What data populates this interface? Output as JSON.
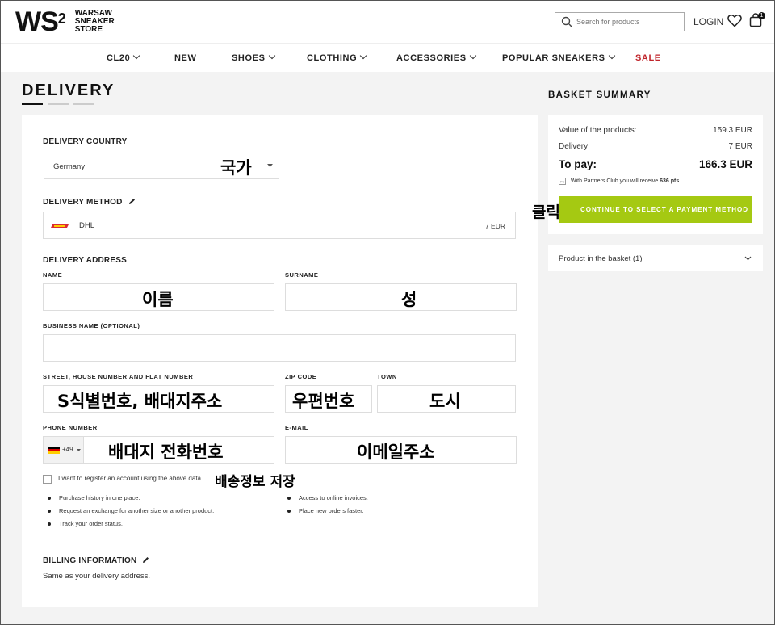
{
  "brand": {
    "mark": "WS",
    "sup": "2",
    "line1": "WARSAW",
    "line2": "SNEAKER",
    "line3": "STORE"
  },
  "header": {
    "search_placeholder": "Search for products",
    "login": "LOGIN",
    "bag_count": "1"
  },
  "nav": [
    {
      "label": "CL20",
      "dropdown": true
    },
    {
      "label": "NEW",
      "dropdown": false
    },
    {
      "label": "SHOES",
      "dropdown": true
    },
    {
      "label": "CLOTHING",
      "dropdown": true
    },
    {
      "label": "ACCESSORIES",
      "dropdown": true
    },
    {
      "label": "POPULAR SNEAKERS",
      "dropdown": true
    },
    {
      "label": "SALE",
      "dropdown": false
    }
  ],
  "page": {
    "title": "DELIVERY"
  },
  "form": {
    "country_label": "DELIVERY COUNTRY",
    "country_value": "Germany",
    "country_note": "국가",
    "method_label": "DELIVERY METHOD",
    "method_name": "DHL",
    "method_price": "7 EUR",
    "address_label": "DELIVERY ADDRESS",
    "name_label": "NAME",
    "name_note": "이름",
    "surname_label": "SURNAME",
    "surname_note": "성",
    "business_label": "BUSINESS NAME (OPTIONAL)",
    "street_label": "STREET, HOUSE NUMBER AND FLAT NUMBER",
    "street_note": "S식별번호, 배대지주소",
    "zip_label": "ZIP CODE",
    "zip_note": "우편번호",
    "town_label": "TOWN",
    "town_note": "도시",
    "phone_label": "PHONE NUMBER",
    "phone_prefix": "+49",
    "phone_note": "배대지 전화번호",
    "email_label": "E-MAIL",
    "email_note": "이메일주소",
    "register_text": "I want to register an account using the above data.",
    "register_note": "배송정보 저장",
    "benefits_left": [
      "Purchase history in one place.",
      "Request an exchange for another size or another product.",
      "Track your order status."
    ],
    "benefits_right": [
      "Access to online invoices.",
      "Place new orders faster."
    ],
    "billing_label": "BILLING INFORMATION",
    "billing_value": "Same as your delivery address."
  },
  "summary": {
    "title": "BASKET SUMMARY",
    "products_label": "Value of the products:",
    "products_value": "159.3 EUR",
    "delivery_label": "Delivery:",
    "delivery_value": "7 EUR",
    "pay_label": "To pay:",
    "pay_value": "166.3 EUR",
    "club_text": "With Partners Club you will receive",
    "club_points": "636 pts",
    "button_label": "CONTINUE TO SELECT A PAYMENT METHOD",
    "click_note": "클릭",
    "basket_label": "Product in the basket (1)"
  },
  "colors": {
    "accent": "#a5c912",
    "sale": "#c0252b"
  }
}
